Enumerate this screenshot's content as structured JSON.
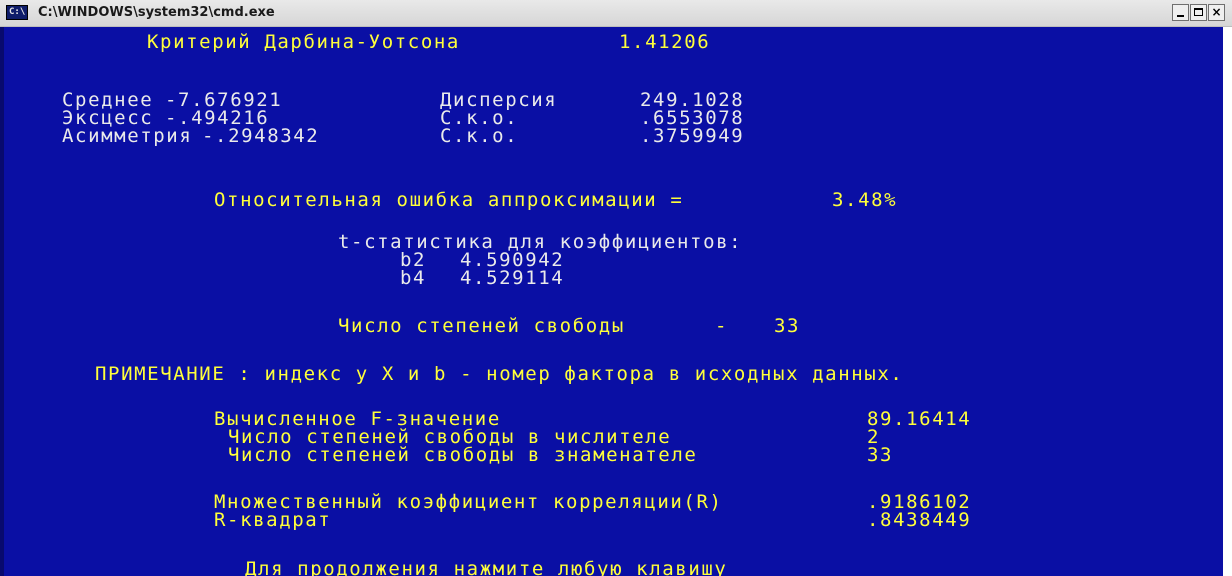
{
  "window": {
    "title": "C:\\WINDOWS\\system32\\cmd.exe",
    "icon_label": "C:\\",
    "buttons": {
      "minimize": "",
      "maximize": "",
      "close": "×"
    }
  },
  "console": {
    "background": "#0a0fa4",
    "text_color": "#eaeaea",
    "highlight_color": "#ffff3a",
    "durbin_watson": {
      "label": "Критерий Дарбина-Уотсона",
      "value": "1.41206"
    },
    "stats": [
      {
        "label": "Среднее",
        "value": "-7.676921",
        "label2": "Дисперсия",
        "value2": "249.1028"
      },
      {
        "label": "Эксцесс",
        "value": "-.494216",
        "label2": "С.к.о.",
        "value2": ".6553078"
      },
      {
        "label": "Асимметрия",
        "value": "-.2948342",
        "label2": "С.к.о.",
        "value2": ".3759949"
      }
    ],
    "approx_error": {
      "label": "Относительная ошибка аппроксимации =",
      "value": "3.48%"
    },
    "t_stat": {
      "header": "t-статистика для коэффициентов:",
      "rows": [
        {
          "name": "b2",
          "value": "4.590942"
        },
        {
          "name": "b4",
          "value": "4.529114"
        }
      ]
    },
    "dof": {
      "label": "Число степеней свободы",
      "sep": "-",
      "value": "33"
    },
    "note": "ПРИМЕЧАНИЕ : индекс у X и b - номер фактора в исходных данных.",
    "f_test": {
      "label": "Вычисленное F-значение",
      "value": "89.16414",
      "num_label": "Число степеней свободы в числителе",
      "num_value": "2",
      "den_label": "Число степеней свободы в знаменателе",
      "den_value": "33"
    },
    "correlation": {
      "r_label": "Множественный коэффициент корреляции(R)",
      "r_value": ".9186102",
      "r2_label": "R-квадрат",
      "r2_value": ".8438449"
    },
    "prompt": "Для продолжения нажмите любую клавишу"
  }
}
